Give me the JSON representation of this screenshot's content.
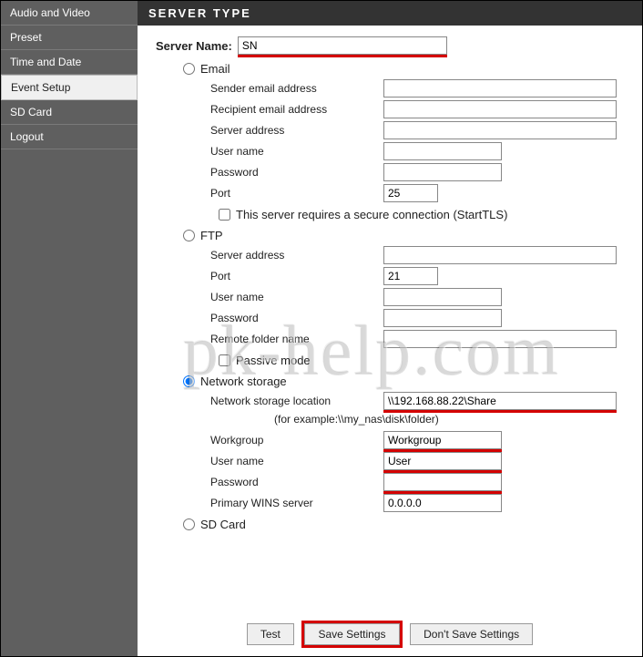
{
  "sidebar": {
    "items": [
      {
        "label": "Audio and Video"
      },
      {
        "label": "Preset"
      },
      {
        "label": "Time and Date"
      },
      {
        "label": "Event Setup"
      },
      {
        "label": "SD Card"
      },
      {
        "label": "Logout"
      }
    ]
  },
  "panel": {
    "title": "SERVER TYPE",
    "server_name_label": "Server Name:",
    "server_name_value": "SN"
  },
  "options": {
    "email": {
      "label": "Email",
      "sender_label": "Sender email address",
      "sender_value": "",
      "recipient_label": "Recipient email address",
      "recipient_value": "",
      "server_label": "Server address",
      "server_value": "",
      "user_label": "User name",
      "user_value": "",
      "password_label": "Password",
      "password_value": "",
      "port_label": "Port",
      "port_value": "25",
      "starttls_label": "This server requires a secure connection (StartTLS)"
    },
    "ftp": {
      "label": "FTP",
      "server_label": "Server address",
      "server_value": "",
      "port_label": "Port",
      "port_value": "21",
      "user_label": "User name",
      "user_value": "",
      "password_label": "Password",
      "password_value": "",
      "remote_folder_label": "Remote folder name",
      "remote_folder_value": "",
      "passive_label": "Passive mode"
    },
    "network_storage": {
      "label": "Network storage",
      "location_label": "Network storage location",
      "location_value": "\\\\192.168.88.22\\Share",
      "example": "(for example:\\\\my_nas\\disk\\folder)",
      "workgroup_label": "Workgroup",
      "workgroup_value": "Workgroup",
      "user_label": "User name",
      "user_value": "User",
      "password_label": "Password",
      "password_value": "",
      "wins_label": "Primary WINS server",
      "wins_value": "0.0.0.0"
    },
    "sd_card": {
      "label": "SD Card"
    }
  },
  "footer": {
    "test": "Test",
    "save": "Save Settings",
    "dont_save": "Don't Save Settings"
  },
  "watermark": "pk-help.com"
}
